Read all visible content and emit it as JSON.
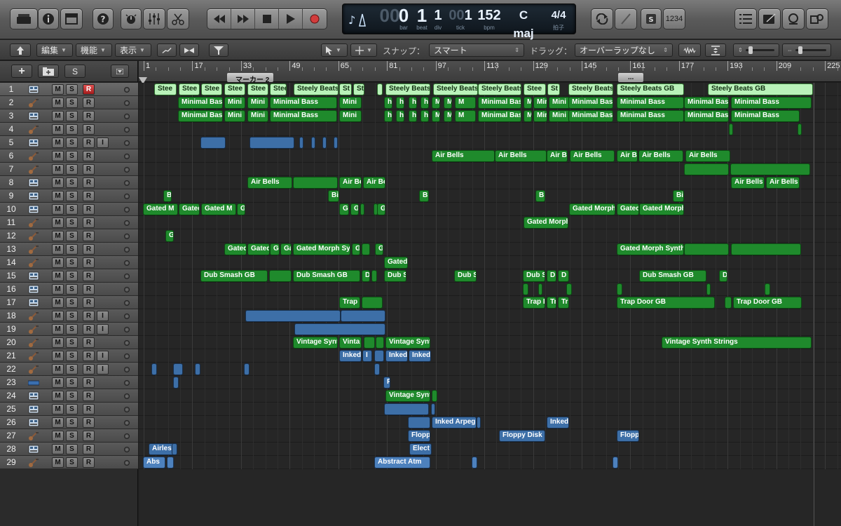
{
  "lcd": {
    "bar": "0",
    "beat": "1",
    "div": "1",
    "tick": "1",
    "bpm": "152",
    "key": "C maj",
    "sig": "4/4",
    "lbl_bar": "bar",
    "lbl_beat": "beat",
    "lbl_div": "div",
    "lbl_tick": "tick",
    "lbl_bpm": "bpm",
    "lbl_key": "キー",
    "lbl_sig": "拍子",
    "counter": "1234"
  },
  "toolbar": {
    "edit_menu": "編集",
    "function_menu": "機能",
    "view_menu": "表示",
    "snap_label": "スナップ：",
    "snap_value": "スマート",
    "drag_label": "ドラッグ：",
    "drag_value": "オーバーラップなし"
  },
  "track_header": {
    "add_label": "+",
    "solo_label": "S"
  },
  "ruler": {
    "bars": [
      "1",
      "17",
      "33",
      "49",
      "65",
      "81",
      "97",
      "113",
      "129",
      "145",
      "161",
      "177",
      "193",
      "209",
      "225"
    ],
    "marker": "マーカー 2",
    "marker2": "..."
  },
  "tracks": [
    {
      "num": "1",
      "rec": true,
      "i": false
    },
    {
      "num": "2",
      "rec": false,
      "i": false
    },
    {
      "num": "3",
      "rec": false,
      "i": false
    },
    {
      "num": "4",
      "rec": false,
      "i": false
    },
    {
      "num": "5",
      "rec": false,
      "i": true
    },
    {
      "num": "6",
      "rec": false,
      "i": false
    },
    {
      "num": "7",
      "rec": false,
      "i": false
    },
    {
      "num": "8",
      "rec": false,
      "i": false
    },
    {
      "num": "9",
      "rec": false,
      "i": false
    },
    {
      "num": "10",
      "rec": false,
      "i": false
    },
    {
      "num": "11",
      "rec": false,
      "i": false
    },
    {
      "num": "12",
      "rec": false,
      "i": false
    },
    {
      "num": "13",
      "rec": false,
      "i": false
    },
    {
      "num": "14",
      "rec": false,
      "i": false
    },
    {
      "num": "15",
      "rec": false,
      "i": false
    },
    {
      "num": "16",
      "rec": false,
      "i": false
    },
    {
      "num": "17",
      "rec": false,
      "i": false
    },
    {
      "num": "18",
      "rec": false,
      "i": true
    },
    {
      "num": "19",
      "rec": false,
      "i": true
    },
    {
      "num": "20",
      "rec": false,
      "i": false
    },
    {
      "num": "21",
      "rec": false,
      "i": true
    },
    {
      "num": "22",
      "rec": false,
      "i": true
    },
    {
      "num": "23",
      "rec": false,
      "i": false
    },
    {
      "num": "24",
      "rec": false,
      "i": false
    },
    {
      "num": "25",
      "rec": false,
      "i": false
    },
    {
      "num": "26",
      "rec": false,
      "i": false
    },
    {
      "num": "27",
      "rec": false,
      "i": false
    },
    {
      "num": "28",
      "rec": false,
      "i": false
    },
    {
      "num": "29",
      "rec": false,
      "i": false
    }
  ],
  "track_buttons": {
    "mute": "M",
    "solo": "S",
    "record": "R",
    "input": "I"
  },
  "regions": {
    "steely_a": "Stee",
    "steely_b": "Steely Beats",
    "steely_c": "St",
    "steely_full": "Steely Beats GB",
    "bass_a": "Minimal Bas",
    "bass_b": "Mini",
    "bass_full": "Minimal Bass",
    "bass_c": "ha",
    "bass_d": "M",
    "air": "Air Bells",
    "air_b": "Air Be",
    "bi": "Bi",
    "gated_a": "Gated M",
    "gated_b": "Gated",
    "gated_c": "Ga",
    "gated_morph": "Gated Morph",
    "gated_full": "Gated Morph Synth",
    "g": "G",
    "dub": "Dub Smash GB",
    "dub_a": "Dub S",
    "dub_b": "D",
    "trap": "Trap Door GB",
    "trap_a": "Trap I",
    "trap_b": "Tr",
    "vintage": "Vintage Synth",
    "vintage_full": "Vintage Synth Strings",
    "vintage_a": "Vinta",
    "inked": "Inked",
    "inked_arp": "Inked Arpeg",
    "i": "I",
    "floppy": "Floppy Disk",
    "floppy_a": "Flopp",
    "elect": "Elect",
    "airless": "Airles",
    "abs": "Abs",
    "abstract": "Abstract Atm",
    "r": "R"
  },
  "colors": {
    "green": "#1f8a2c",
    "light_green": "#b9f2b9",
    "blue": "#3d6fa7",
    "record": "#d23c3c"
  }
}
